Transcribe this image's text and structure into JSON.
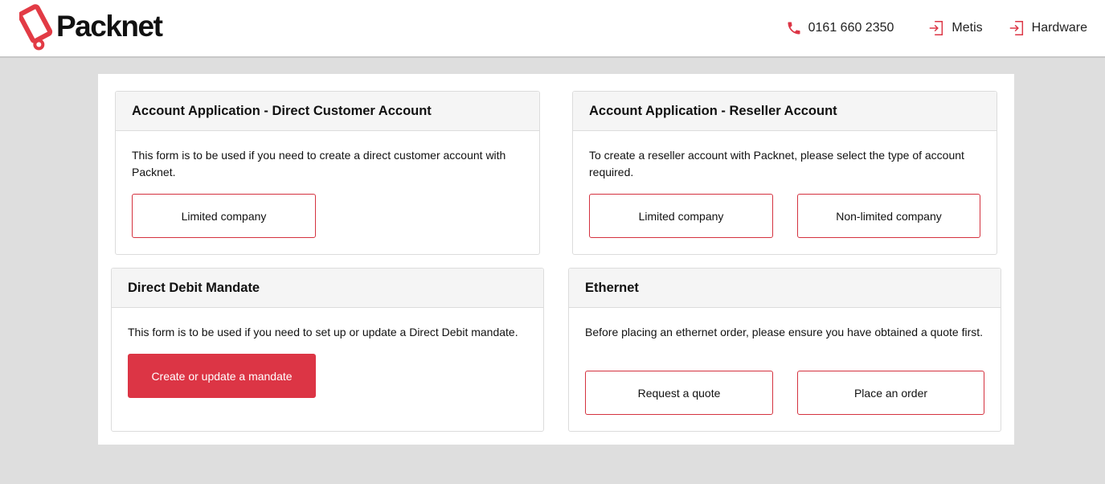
{
  "header": {
    "brand": "Packnet",
    "phone": "0161 660 2350",
    "links": [
      {
        "label": "Metis",
        "icon": "sign-in-icon"
      },
      {
        "label": "Hardware",
        "icon": "sign-in-icon"
      }
    ]
  },
  "colors": {
    "accent": "#dc3545",
    "page_bg": "#dedede",
    "panel_head_bg": "#f5f5f5"
  },
  "panels": {
    "direct": {
      "title": "Account Application - Direct Customer Account",
      "description": "This form is to be used if you need to create a direct customer account with Packnet.",
      "buttons": [
        "Limited company"
      ]
    },
    "reseller": {
      "title": "Account Application - Reseller Account",
      "description": "To create a reseller account with Packnet, please select the type of account required.",
      "buttons": [
        "Limited company",
        "Non-limited company"
      ]
    },
    "debit": {
      "title": "Direct Debit Mandate",
      "description": "This form is to be used if you need to set up or update a Direct Debit mandate.",
      "buttons": [
        "Create or update a mandate"
      ]
    },
    "ethernet": {
      "title": "Ethernet",
      "description": "Before placing an ethernet order, please ensure you have obtained a quote first.",
      "buttons": [
        "Request a quote",
        "Place an order"
      ]
    }
  }
}
